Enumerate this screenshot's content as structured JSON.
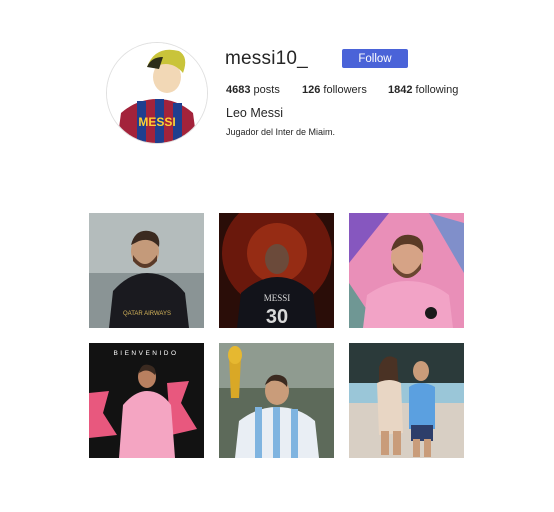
{
  "profile": {
    "username": "messi10_",
    "follow_label": "Follow",
    "posts_count": "4683",
    "posts_label": "posts",
    "followers_count": "126",
    "followers_label": "followers",
    "following_count": "1842",
    "following_label": "following",
    "full_name": "Leo Messi",
    "bio": "Jugador del Inter de Miaim.",
    "avatar_text": "MESSI"
  },
  "posts": [
    {
      "subject": "psg-black-kit-photo",
      "overlay_text": "QATAR AIRWAYS"
    },
    {
      "subject": "back-view-number-30",
      "overlay_text": "MESSI"
    },
    {
      "subject": "inter-miami-pink-portrait",
      "overlay_text": ""
    },
    {
      "subject": "bienvenido-inter-miami",
      "overlay_text": "BIENVENIDO"
    },
    {
      "subject": "world-cup-trophy-argentina",
      "overlay_text": ""
    },
    {
      "subject": "couple-photo-poolside",
      "overlay_text": ""
    }
  ],
  "colors": {
    "follow_button": "#4a63d8",
    "text": "#262626"
  }
}
